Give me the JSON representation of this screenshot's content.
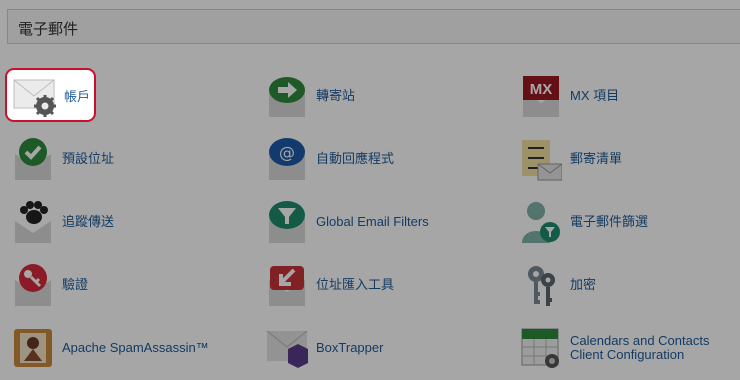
{
  "section": {
    "title": "電子郵件"
  },
  "items": [
    {
      "label": "帳戶",
      "icon": "envelope-gear-icon"
    },
    {
      "label": "轉寄站",
      "icon": "forwarder-arrow-icon"
    },
    {
      "label": "MX 項目",
      "icon": "mx-entry-icon"
    },
    {
      "label": "預設位址",
      "icon": "default-address-check-icon"
    },
    {
      "label": "自動回應程式",
      "icon": "autoresponder-at-icon"
    },
    {
      "label": "郵寄清單",
      "icon": "mailing-list-icon"
    },
    {
      "label": "追蹤傳送",
      "icon": "track-delivery-paw-icon"
    },
    {
      "label": "Global Email Filters",
      "icon": "global-filter-funnel-icon"
    },
    {
      "label": "電子郵件篩選",
      "icon": "email-filter-person-icon"
    },
    {
      "label": "驗證",
      "icon": "authentication-key-icon"
    },
    {
      "label": "位址匯入工具",
      "icon": "address-importer-icon"
    },
    {
      "label": "加密",
      "icon": "encryption-keys-icon"
    },
    {
      "label": "Apache SpamAssassin™",
      "icon": "spamassassin-icon"
    },
    {
      "label": "BoxTrapper",
      "icon": "boxtrapper-icon"
    },
    {
      "label": "Calendars and Contacts Client Configuration",
      "icon": "calendar-contacts-icon"
    }
  ],
  "colors": {
    "link": "#1f5b99",
    "highlight_border": "#c8102e",
    "overlay": "rgba(0,0,0,0.35)"
  }
}
